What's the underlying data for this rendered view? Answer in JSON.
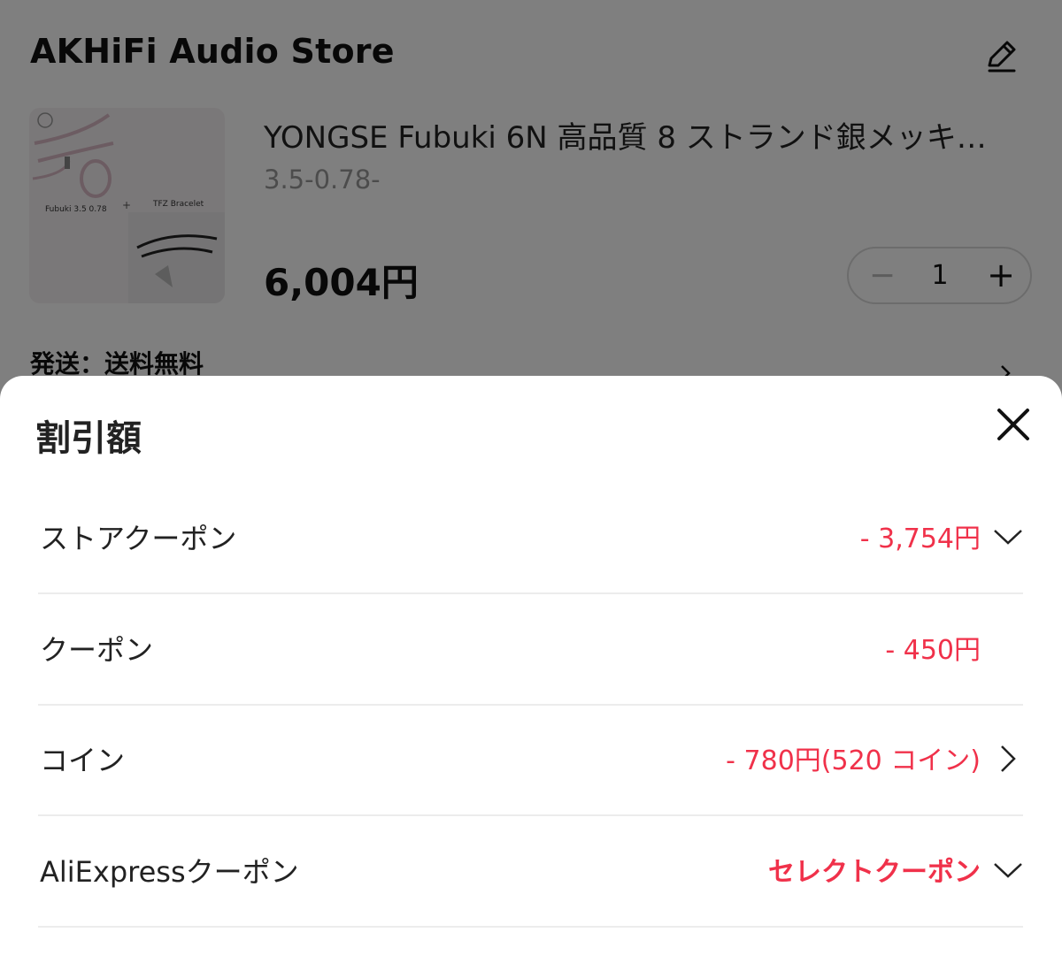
{
  "store": {
    "name": "AKHiFi Audio Store",
    "edit_icon": "edit-pencil-icon"
  },
  "product": {
    "thumbnail": {
      "caption_cable": "Fubuki 3.5  0.78",
      "caption_plus": "+",
      "caption_bracelet": "TFZ Bracelet"
    },
    "name": "YONGSE Fubuki 6N 高品質 8 ストランド銀メッキ…",
    "variant": "3.5-0.78-",
    "price": "6,004円",
    "quantity": {
      "minus_icon": "minus-icon",
      "value": "1",
      "plus_icon": "plus-icon"
    }
  },
  "shipping": {
    "label": "発送：送料無料",
    "icon": "chevron-right-icon"
  },
  "sheet": {
    "title": "割引額",
    "close_icon": "close-icon",
    "rows": [
      {
        "label": "ストアクーポン",
        "value": "- 3,754円",
        "icon": "chevron-down-icon"
      },
      {
        "label": "クーポン",
        "value": "- 450円",
        "icon": ""
      },
      {
        "label": "コイン",
        "value": "- 780円(520 コイン)",
        "icon": "chevron-right-icon"
      },
      {
        "label": "AliExpressクーポン",
        "value": "セレクトクーポン",
        "icon": "chevron-down-icon"
      }
    ]
  },
  "colors": {
    "accent_red": "#f0314a",
    "text_primary": "#222222",
    "text_muted": "#999999",
    "divider": "#ececec",
    "overlay_dim": "rgba(0,0,0,0.5)"
  }
}
